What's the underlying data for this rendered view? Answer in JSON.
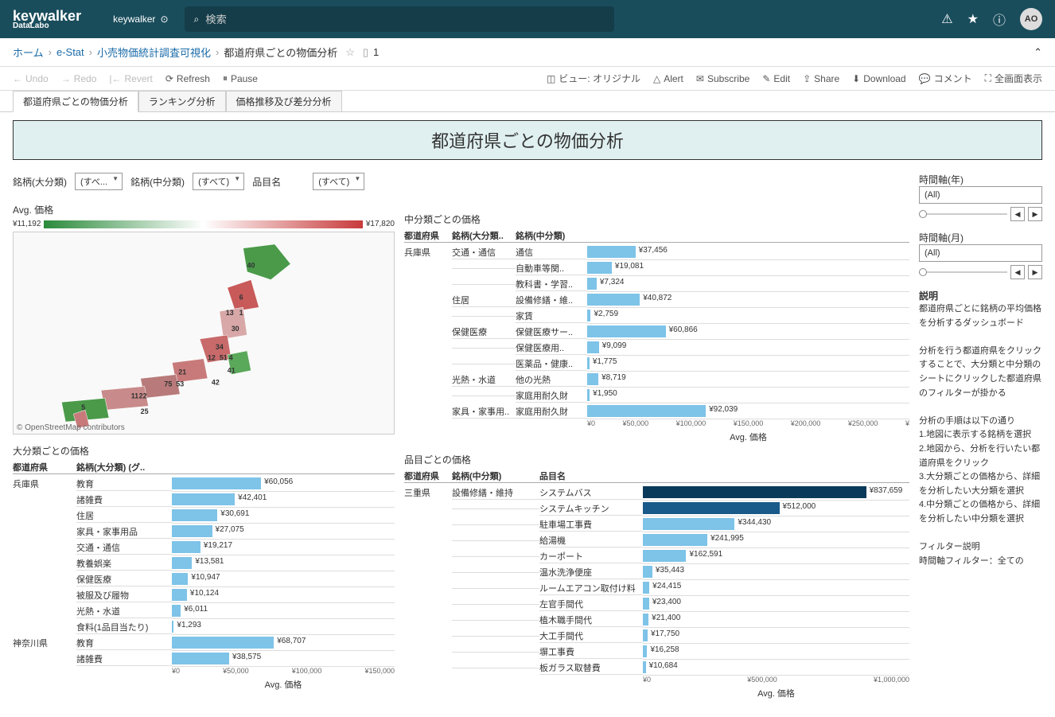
{
  "header": {
    "logo_main": "keywalker",
    "logo_sub": "DataLabo",
    "site": "keywalker",
    "search_placeholder": "検索",
    "avatar": "AO"
  },
  "breadcrumb": {
    "items": [
      "ホーム",
      "e-Stat",
      "小売物価統計調査可視化",
      "都道府県ごとの物価分析"
    ],
    "doc_count": "1"
  },
  "toolbar": {
    "undo": "Undo",
    "redo": "Redo",
    "revert": "Revert",
    "refresh": "Refresh",
    "pause": "Pause",
    "view": "ビュー: オリジナル",
    "alert": "Alert",
    "subscribe": "Subscribe",
    "edit": "Edit",
    "share": "Share",
    "download": "Download",
    "comment": "コメント",
    "fullscreen": "全画面表示"
  },
  "tabs": [
    "都道府県ごとの物価分析",
    "ランキング分析",
    "価格推移及び差分分析"
  ],
  "title": "都道府県ごとの物価分析",
  "filters": {
    "f1_label": "銘柄(大分類)",
    "f1_value": "(すべ...",
    "f2_label": "銘柄(中分類)",
    "f2_value": "(すべて)",
    "f3_label": "品目名",
    "f3_value": "(すべて)"
  },
  "map_section": {
    "title": "Avg. 価格",
    "legend_min": "¥11,192",
    "legend_max": "¥17,820",
    "credit": "© OpenStreetMap contributors"
  },
  "chart_data": [
    {
      "id": "large_category",
      "title": "大分類ごとの価格",
      "type": "bar",
      "columns": [
        "都道府県",
        "銘柄(大分類) (グ.."
      ],
      "xlabel": "Avg. 価格",
      "xlim": [
        0,
        150000
      ],
      "xticks": [
        "¥0",
        "¥50,000",
        "¥100,000",
        "¥150,000"
      ],
      "rows": [
        {
          "pref": "兵庫県",
          "cat": "教育",
          "value": 60056,
          "label": "¥60,056"
        },
        {
          "pref": "",
          "cat": "諸雑費",
          "value": 42401,
          "label": "¥42,401"
        },
        {
          "pref": "",
          "cat": "住居",
          "value": 30691,
          "label": "¥30,691"
        },
        {
          "pref": "",
          "cat": "家具・家事用品",
          "value": 27075,
          "label": "¥27,075"
        },
        {
          "pref": "",
          "cat": "交通・通信",
          "value": 19217,
          "label": "¥19,217"
        },
        {
          "pref": "",
          "cat": "教養娯楽",
          "value": 13581,
          "label": "¥13,581"
        },
        {
          "pref": "",
          "cat": "保健医療",
          "value": 10947,
          "label": "¥10,947"
        },
        {
          "pref": "",
          "cat": "被服及び履物",
          "value": 10124,
          "label": "¥10,124"
        },
        {
          "pref": "",
          "cat": "光熱・水道",
          "value": 6011,
          "label": "¥6,011"
        },
        {
          "pref": "",
          "cat": "食料(1品目当たり)",
          "value": 1293,
          "label": "¥1,293"
        },
        {
          "pref": "神奈川県",
          "cat": "教育",
          "value": 68707,
          "label": "¥68,707"
        },
        {
          "pref": "",
          "cat": "諸雑費",
          "value": 38575,
          "label": "¥38,575"
        }
      ]
    },
    {
      "id": "mid_category",
      "title": "中分類ごとの価格",
      "type": "bar",
      "columns": [
        "都道府県",
        "銘柄(大分類..",
        "銘柄(中分類)"
      ],
      "xlabel": "Avg. 価格",
      "xlim": [
        0,
        250000
      ],
      "xticks": [
        "¥0",
        "¥50,000",
        "¥100,000",
        "¥150,000",
        "¥200,000",
        "¥250,000",
        "¥"
      ],
      "rows": [
        {
          "pref": "兵庫県",
          "cat": "交通・通信",
          "sub": "通信",
          "value": 37456,
          "label": "¥37,456"
        },
        {
          "pref": "",
          "cat": "",
          "sub": "自動車等関..",
          "value": 19081,
          "label": "¥19,081"
        },
        {
          "pref": "",
          "cat": "",
          "sub": "教科書・学習..",
          "value": 7324,
          "label": "¥7,324"
        },
        {
          "pref": "",
          "cat": "住居",
          "sub": "設備修繕・維..",
          "value": 40872,
          "label": "¥40,872"
        },
        {
          "pref": "",
          "cat": "",
          "sub": "家賃",
          "value": 2759,
          "label": "¥2,759"
        },
        {
          "pref": "",
          "cat": "保健医療",
          "sub": "保健医療サー..",
          "value": 60866,
          "label": "¥60,866"
        },
        {
          "pref": "",
          "cat": "",
          "sub": "保健医療用..",
          "value": 9099,
          "label": "¥9,099"
        },
        {
          "pref": "",
          "cat": "",
          "sub": "医薬品・健康..",
          "value": 1775,
          "label": "¥1,775"
        },
        {
          "pref": "",
          "cat": "光熱・水道",
          "sub": "他の光熱",
          "value": 8719,
          "label": "¥8,719"
        },
        {
          "pref": "",
          "cat": "",
          "sub": "家庭用耐久財",
          "value": 1950,
          "label": "¥1,950"
        },
        {
          "pref": "",
          "cat": "家具・家事用..",
          "sub": "家庭用耐久財",
          "value": 92039,
          "label": "¥92,039"
        }
      ]
    },
    {
      "id": "item",
      "title": "品目ごとの価格",
      "type": "bar",
      "columns": [
        "都道府県",
        "銘柄(中分類)",
        "品目名"
      ],
      "xlabel": "Avg. 価格",
      "xlim": [
        0,
        1000000
      ],
      "xticks": [
        "¥0",
        "¥500,000",
        "¥1,000,000"
      ],
      "rows": [
        {
          "pref": "三重県",
          "cat": "設備修繕・維持",
          "sub": "システムバス",
          "value": 837659,
          "label": "¥837,659",
          "dark": 2
        },
        {
          "pref": "",
          "cat": "",
          "sub": "システムキッチン",
          "value": 512000,
          "label": "¥512,000",
          "dark": 1
        },
        {
          "pref": "",
          "cat": "",
          "sub": "駐車場工事費",
          "value": 344430,
          "label": "¥344,430"
        },
        {
          "pref": "",
          "cat": "",
          "sub": "給湯機",
          "value": 241995,
          "label": "¥241,995"
        },
        {
          "pref": "",
          "cat": "",
          "sub": "カーポート",
          "value": 162591,
          "label": "¥162,591"
        },
        {
          "pref": "",
          "cat": "",
          "sub": "温水洗浄便座",
          "value": 35443,
          "label": "¥35,443"
        },
        {
          "pref": "",
          "cat": "",
          "sub": "ルームエアコン取付け料",
          "value": 24415,
          "label": "¥24,415"
        },
        {
          "pref": "",
          "cat": "",
          "sub": "左官手間代",
          "value": 23400,
          "label": "¥23,400"
        },
        {
          "pref": "",
          "cat": "",
          "sub": "植木職手間代",
          "value": 21400,
          "label": "¥21,400"
        },
        {
          "pref": "",
          "cat": "",
          "sub": "大工手間代",
          "value": 17750,
          "label": "¥17,750"
        },
        {
          "pref": "",
          "cat": "",
          "sub": "塀工事費",
          "value": 16258,
          "label": "¥16,258"
        },
        {
          "pref": "",
          "cat": "",
          "sub": "板ガラス取替費",
          "value": 10684,
          "label": "¥10,684"
        }
      ]
    }
  ],
  "side": {
    "year_label": "時間軸(年)",
    "year_value": "(All)",
    "month_label": "時間軸(月)",
    "month_value": "(All)",
    "desc_title": "説明",
    "desc_p1": "都道府県ごとに銘柄の平均価格を分析するダッシュボード",
    "desc_p2": "分析を行う都道府県をクリックすることで、大分類と中分類のシートにクリックした都道府県のフィルターが掛かる",
    "desc_p3": "分析の手順は以下の通り",
    "desc_s1": "1.地図に表示する銘柄を選択",
    "desc_s2": "2.地図から、分析を行いたい都道府県をクリック",
    "desc_s3": "3.大分類ごとの価格から、詳細を分析したい大分類を選択",
    "desc_s4": "4.中分類ごとの価格から、詳細を分析したい中分類を選択",
    "desc_filter_title": "フィルター説明",
    "desc_filter": "時間軸フィルター：全ての"
  }
}
